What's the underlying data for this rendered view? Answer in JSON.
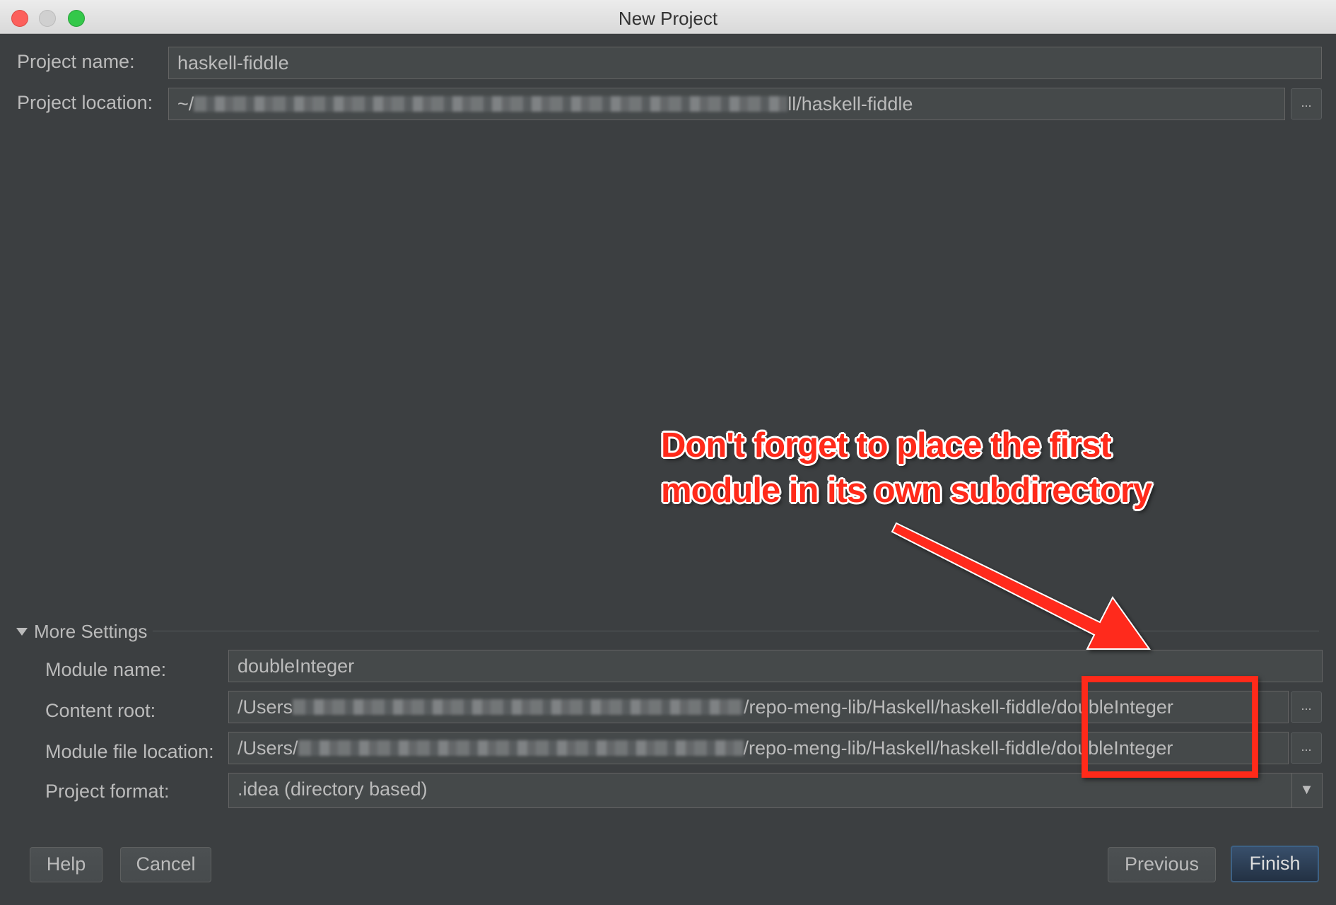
{
  "window": {
    "title": "New Project"
  },
  "project": {
    "name_label": "Project name:",
    "name_value": "haskell-fiddle",
    "location_label": "Project location:",
    "location_prefix": "~/",
    "location_suffix": "ll/haskell-fiddle",
    "browse_label": "..."
  },
  "more_settings": {
    "title": "More Settings",
    "module_name_label": "Module name:",
    "module_name_value": "doubleInteger",
    "content_root_label": "Content root:",
    "content_root_prefix": "/Users",
    "content_root_suffix": "/repo-meng-lib/Haskell/haskell-fiddle/doubleInteger",
    "module_file_label": "Module file location:",
    "module_file_prefix": "/Users/",
    "module_file_suffix": "/repo-meng-lib/Haskell/haskell-fiddle/doubleInteger",
    "format_label": "Project format:",
    "format_value": ".idea (directory based)",
    "browse_label": "..."
  },
  "buttons": {
    "help": "Help",
    "cancel": "Cancel",
    "previous": "Previous",
    "finish": "Finish"
  },
  "annotation": {
    "line1": "Don't forget to place the first",
    "line2": "module in its own subdirectory",
    "color": "#ff2a1a"
  },
  "icons": {
    "combo_arrow": "triangle-down-icon",
    "section_toggle": "triangle-down-icon"
  }
}
